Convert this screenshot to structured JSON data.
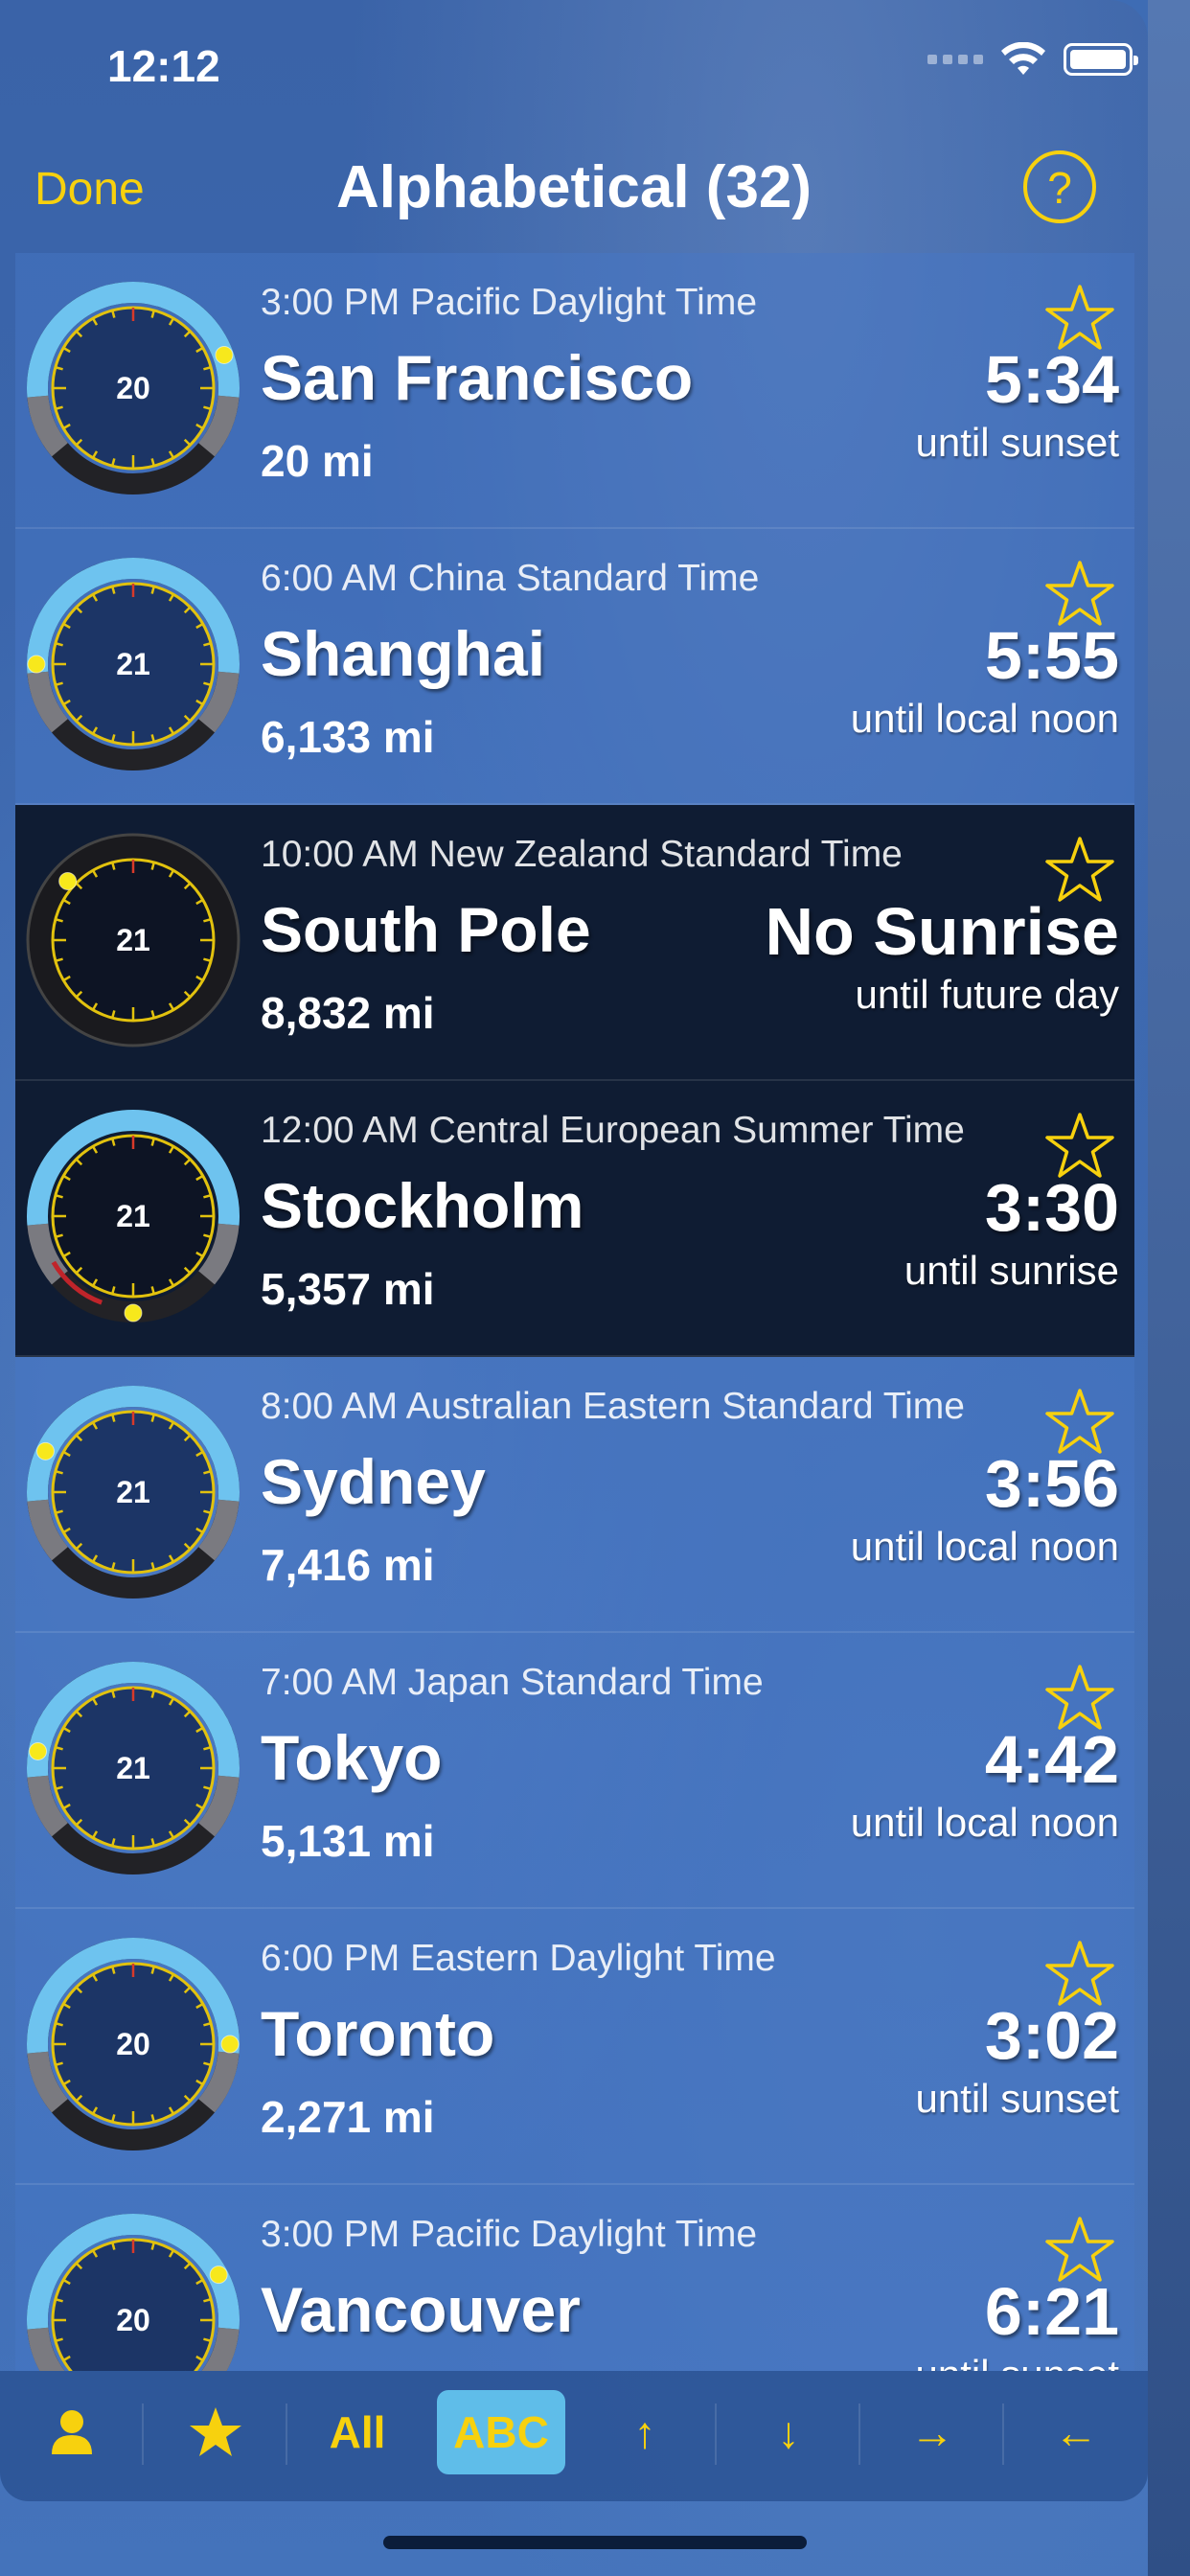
{
  "status_bar": {
    "time": "12:12"
  },
  "nav": {
    "done_label": "Done",
    "title": "Alphabetical (32)",
    "help_label": "?"
  },
  "colors": {
    "accent": "#f7d10e",
    "day_row": "#4a7cc8",
    "night_row": "#0f1c33",
    "dial_sky": "#6ec3ef",
    "dial_face": "#1c3566"
  },
  "rows": [
    {
      "tz": "3:00 PM Pacific Daylight Time",
      "city": "San Francisco",
      "dist": "20 mi",
      "value": "5:34",
      "until": "until sunset",
      "dial": "20",
      "mode": "day",
      "sun_angle": 70
    },
    {
      "tz": "6:00 AM China Standard Time",
      "city": "Shanghai",
      "dist": "6,133 mi",
      "value": "5:55",
      "until": "until local noon",
      "dial": "21",
      "mode": "day",
      "sun_angle": 270
    },
    {
      "tz": "10:00 AM New Zealand Standard Time",
      "city": "South Pole",
      "dist": "8,832 mi",
      "value": "No Sunrise",
      "until": "until future day",
      "dial": "21",
      "mode": "polar",
      "sun_angle": 312
    },
    {
      "tz": "12:00 AM Central European Summer Time",
      "city": "Stockholm",
      "dist": "5,357 mi",
      "value": "3:30",
      "until": "until sunrise",
      "dial": "21",
      "mode": "night",
      "sun_angle": 180
    },
    {
      "tz": "8:00 AM Australian Eastern Standard Time",
      "city": "Sydney",
      "dist": "7,416 mi",
      "value": "3:56",
      "until": "until local noon",
      "dial": "21",
      "mode": "day",
      "sun_angle": 295
    },
    {
      "tz": "7:00 AM Japan Standard Time",
      "city": "Tokyo",
      "dist": "5,131 mi",
      "value": "4:42",
      "until": "until local noon",
      "dial": "21",
      "mode": "day",
      "sun_angle": 280
    },
    {
      "tz": "6:00 PM Eastern Daylight Time",
      "city": "Toronto",
      "dist": "2,271 mi",
      "value": "3:02",
      "until": "until sunset",
      "dial": "20",
      "mode": "day",
      "sun_angle": 90
    },
    {
      "tz": "3:00 PM Pacific Daylight Time",
      "city": "Vancouver",
      "dist": "",
      "value": "6:21",
      "until": "until sunset",
      "dial": "20",
      "mode": "day",
      "sun_angle": 62
    }
  ],
  "toolbar": {
    "all_label": "All",
    "abc_label": "ABC",
    "up_label": "↑",
    "down_label": "↓",
    "right_label": "→",
    "left_label": "←"
  }
}
